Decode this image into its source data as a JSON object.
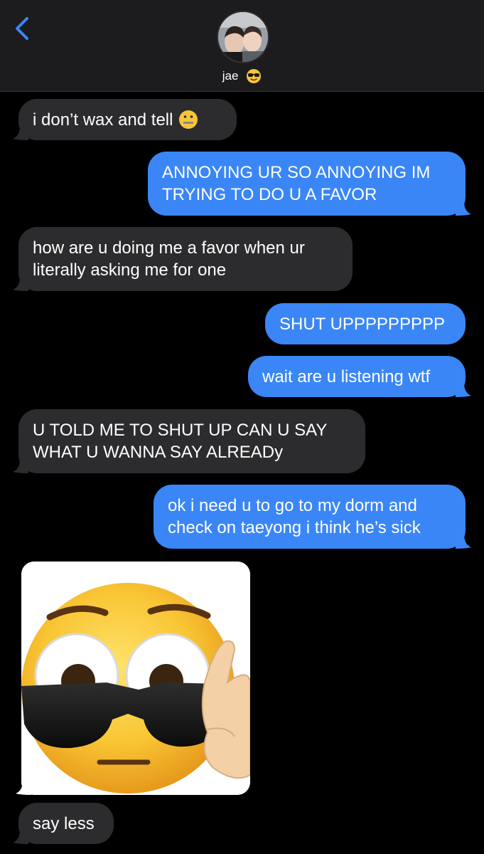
{
  "header": {
    "contact_name": "jae",
    "contact_emoji": "smiling-face-with-sunglasses",
    "back_icon": "chevron-left-icon",
    "accent": "#3a86f6"
  },
  "messages": [
    {
      "from": "them",
      "lines": [
        "i don’t wax and tell"
      ],
      "emoji": "zipper-mouth-face"
    },
    {
      "from": "me",
      "lines": [
        "ANNOYING UR SO ANNOYING IM",
        "TRYING TO DO U A FAVOR"
      ]
    },
    {
      "from": "them",
      "lines": [
        "how are u doing me a favor when ur",
        "literally asking me for one"
      ]
    },
    {
      "from": "me",
      "lines": [
        "SHUT UPPPPPPPPP"
      ]
    },
    {
      "from": "me",
      "lines": [
        "wait are u listening wtf"
      ]
    },
    {
      "from": "them",
      "lines": [
        "U TOLD ME TO SHUT UP CAN U SAY",
        "WHAT U WANNA SAY ALREADy"
      ]
    },
    {
      "from": "me",
      "lines": [
        "ok i need u to go to my dorm and",
        "check on taeyong i think he’s sick"
      ]
    },
    {
      "from": "them",
      "type": "image",
      "image": "flushed-face-with-sunglasses-emoji"
    },
    {
      "from": "them",
      "lines": [
        "say less"
      ]
    }
  ],
  "colors": {
    "received_bubble": "#2c2c2e",
    "sent_bubble": "#3a86f6",
    "background": "#000000",
    "header_bg": "#1c1c1e"
  }
}
